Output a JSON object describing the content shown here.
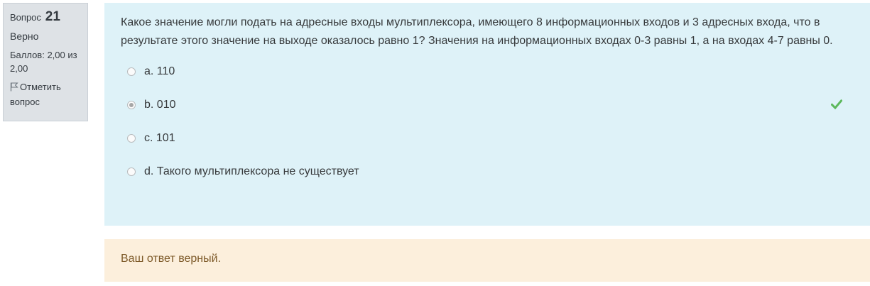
{
  "info": {
    "question_label": "Вопрос",
    "question_number": "21",
    "state": "Верно",
    "grade": "Баллов: 2,00 из 2,00",
    "flag_label": "Отметить вопрос"
  },
  "question": {
    "text": "Какое значение могли подать на адресные входы мультиплексора, имеющего 8 информационных входов и 3 адресных входа, что в результате этого значение на выходе оказалось равно 1? Значения на информационных входах 0-3 равны 1, а на входах 4-7 равны 0.",
    "answers": [
      {
        "label": "a. 110",
        "selected": false,
        "correct_mark": false
      },
      {
        "label": "b. 010",
        "selected": true,
        "correct_mark": true
      },
      {
        "label": "c. 101",
        "selected": false,
        "correct_mark": false
      },
      {
        "label": "d. Такого мультиплексора не существует",
        "selected": false,
        "correct_mark": false
      }
    ],
    "icons": {
      "flag": "flag-icon",
      "correct": "check-icon"
    },
    "colors": {
      "correct": "#5cb85c",
      "formulation_bg": "#def2f8",
      "outcome_bg": "#fcefdc"
    }
  },
  "feedback": {
    "text": "Ваш ответ верный."
  }
}
